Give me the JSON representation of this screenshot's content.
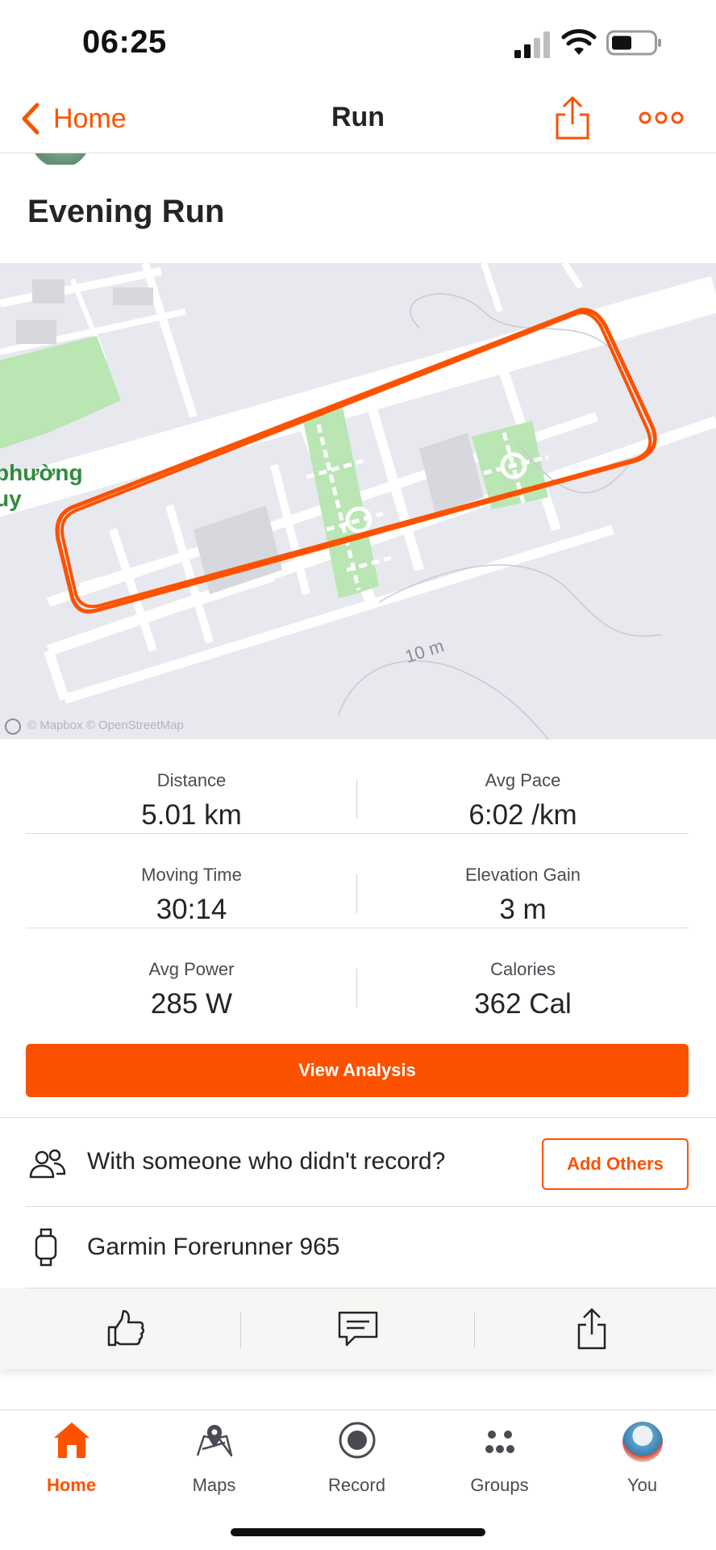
{
  "status_bar": {
    "time": "06:25"
  },
  "nav": {
    "back_label": "Home",
    "title": "Run"
  },
  "activity": {
    "title": "Evening Run"
  },
  "map": {
    "place_label": "phường\nuy",
    "elevation_label": "10 m",
    "attribution": "© Mapbox © OpenStreetMap",
    "route_color": "#fc5200",
    "park_color": "#b9e6b3"
  },
  "stats": [
    {
      "left": {
        "label": "Distance",
        "value": "5.01 km"
      },
      "right": {
        "label": "Avg Pace",
        "value": "6:02 /km"
      }
    },
    {
      "left": {
        "label": "Moving Time",
        "value": "30:14"
      },
      "right": {
        "label": "Elevation Gain",
        "value": "3 m"
      }
    },
    {
      "left": {
        "label": "Avg Power",
        "value": "285 W"
      },
      "right": {
        "label": "Calories",
        "value": "362 Cal"
      }
    }
  ],
  "analysis_button": "View Analysis",
  "others": {
    "text": "With someone who didn't record?",
    "button": "Add Others"
  },
  "device": {
    "name": "Garmin Forerunner 965"
  },
  "actions": {
    "like_icon": "thumbs-up-icon",
    "comment_icon": "comment-icon",
    "share_icon": "share-icon"
  },
  "tabs": [
    {
      "label": "Home",
      "icon": "home-icon",
      "active": true
    },
    {
      "label": "Maps",
      "icon": "maps-icon"
    },
    {
      "label": "Record",
      "icon": "record-icon"
    },
    {
      "label": "Groups",
      "icon": "groups-icon"
    },
    {
      "label": "You",
      "icon": "avatar"
    }
  ],
  "colors": {
    "accent": "#fc5200",
    "text": "#242428",
    "map_bg": "#e8e8ef"
  }
}
